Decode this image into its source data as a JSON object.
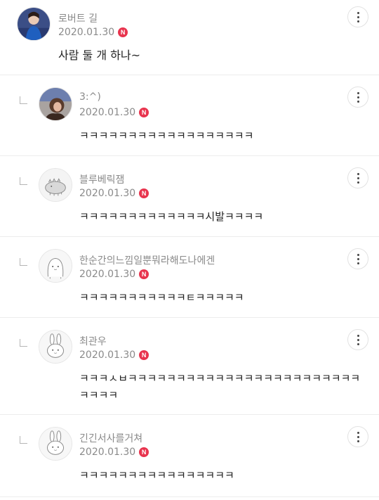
{
  "accent": {
    "new_badge": "#e8344e"
  },
  "new_badge_label": "N",
  "comments": [
    {
      "author": "로버트 길",
      "date": "2020.01.30",
      "text": "사람 둘 개 하나~",
      "avatar_icon": "photo-avatar-blue"
    },
    {
      "author": "3:^)",
      "date": "2020.01.30",
      "text": "ㅋㅋㅋㅋㅋㅋㅋㅋㅋㅋㅋㅋㅋㅋㅋㅋㅋㅋ",
      "avatar_icon": "photo-avatar-brown"
    },
    {
      "author": "블루베릭잼",
      "date": "2020.01.30",
      "text": "ㅋㅋㅋㅋㅋㅋㅋㅋㅋㅋㅋㅋㅋ시발ㅋㅋㅋㅋ",
      "avatar_icon": "dinosaur-avatar"
    },
    {
      "author": "한순간의느낌일뿐뭐라해도나에겐",
      "date": "2020.01.30",
      "text": "ㅋㅋㅋㅋㅋㅋㅋㅋㅋㅋㅋㅌㅋㅋㅋㅋㅋ",
      "avatar_icon": "ghost-avatar"
    },
    {
      "author": "최관우",
      "date": "2020.01.30",
      "text": "ㅋㅋㅋㅅㅂㅋㅋㅋㅋㅋㅋㅋㅋㅋㅋㅋㅋㅋㅋㅋㅋㅋㅋㅋㅋㅋㅋㅋㅋㅋㅋㅋㅋ",
      "avatar_icon": "bunny-avatar"
    },
    {
      "author": "긴긴서사를거쳐",
      "date": "2020.01.30",
      "text": "ㅋㅋㅋㅋㅋㅋㅋㅋㅋㅋㅋㅋㅋㅋㅋㅋ",
      "avatar_icon": "bunny-avatar"
    }
  ]
}
